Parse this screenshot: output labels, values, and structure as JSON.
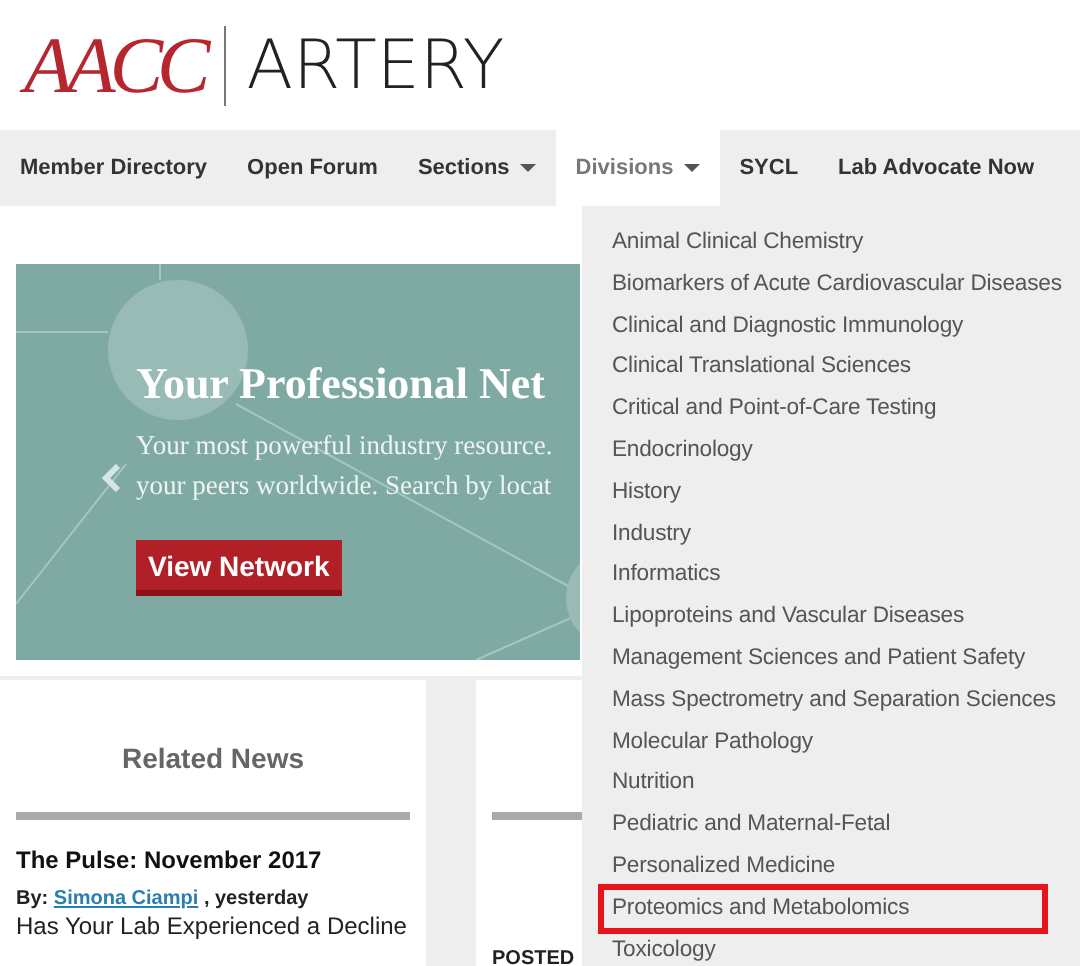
{
  "logo": {
    "brand": "AACC",
    "product": "ARTERY"
  },
  "nav": [
    {
      "label": "Member Directory",
      "dropdown": false,
      "selected": false
    },
    {
      "label": "Open Forum",
      "dropdown": false,
      "selected": false
    },
    {
      "label": "Sections",
      "dropdown": true,
      "selected": false
    },
    {
      "label": "Divisions",
      "dropdown": true,
      "selected": true
    },
    {
      "label": "SYCL",
      "dropdown": false,
      "selected": false
    },
    {
      "label": "Lab Advocate Now",
      "dropdown": false,
      "selected": false
    }
  ],
  "divisions_menu": [
    {
      "label": "Animal Clinical Chemistry",
      "highlighted": false
    },
    {
      "label": "Biomarkers of Acute Cardiovascular Diseases",
      "highlighted": false
    },
    {
      "label": "Clinical and Diagnostic Immunology",
      "highlighted": false
    },
    {
      "label": "Clinical Translational Sciences",
      "highlighted": false
    },
    {
      "label": "Critical and Point-of-Care Testing",
      "highlighted": false
    },
    {
      "label": "Endocrinology",
      "highlighted": false
    },
    {
      "label": "History",
      "highlighted": false
    },
    {
      "label": "Industry",
      "highlighted": false
    },
    {
      "label": "Informatics",
      "highlighted": false
    },
    {
      "label": "Lipoproteins and Vascular Diseases",
      "highlighted": false
    },
    {
      "label": "Management Sciences and Patient Safety",
      "highlighted": false
    },
    {
      "label": "Mass Spectrometry and Separation Sciences",
      "highlighted": false
    },
    {
      "label": "Molecular Pathology",
      "highlighted": false
    },
    {
      "label": "Nutrition",
      "highlighted": false
    },
    {
      "label": "Pediatric and Maternal-Fetal",
      "highlighted": false
    },
    {
      "label": "Personalized Medicine",
      "highlighted": false
    },
    {
      "label": "Proteomics and Metabolomics",
      "highlighted": true
    },
    {
      "label": "Toxicology",
      "highlighted": false
    }
  ],
  "hero": {
    "title": "Your Professional Net",
    "text_lines": [
      "Your most powerful industry resource.",
      "your peers worldwide. Search by locat"
    ],
    "button": "View Network"
  },
  "related_news": {
    "heading": "Related News",
    "item_title": "The Pulse: November 2017",
    "by_label": "By:",
    "author": "Simona Ciampi",
    "when": ", yesterday",
    "excerpt": "Has Your Lab Experienced a Decline"
  },
  "column_2": {
    "posted_label": "POSTED"
  }
}
